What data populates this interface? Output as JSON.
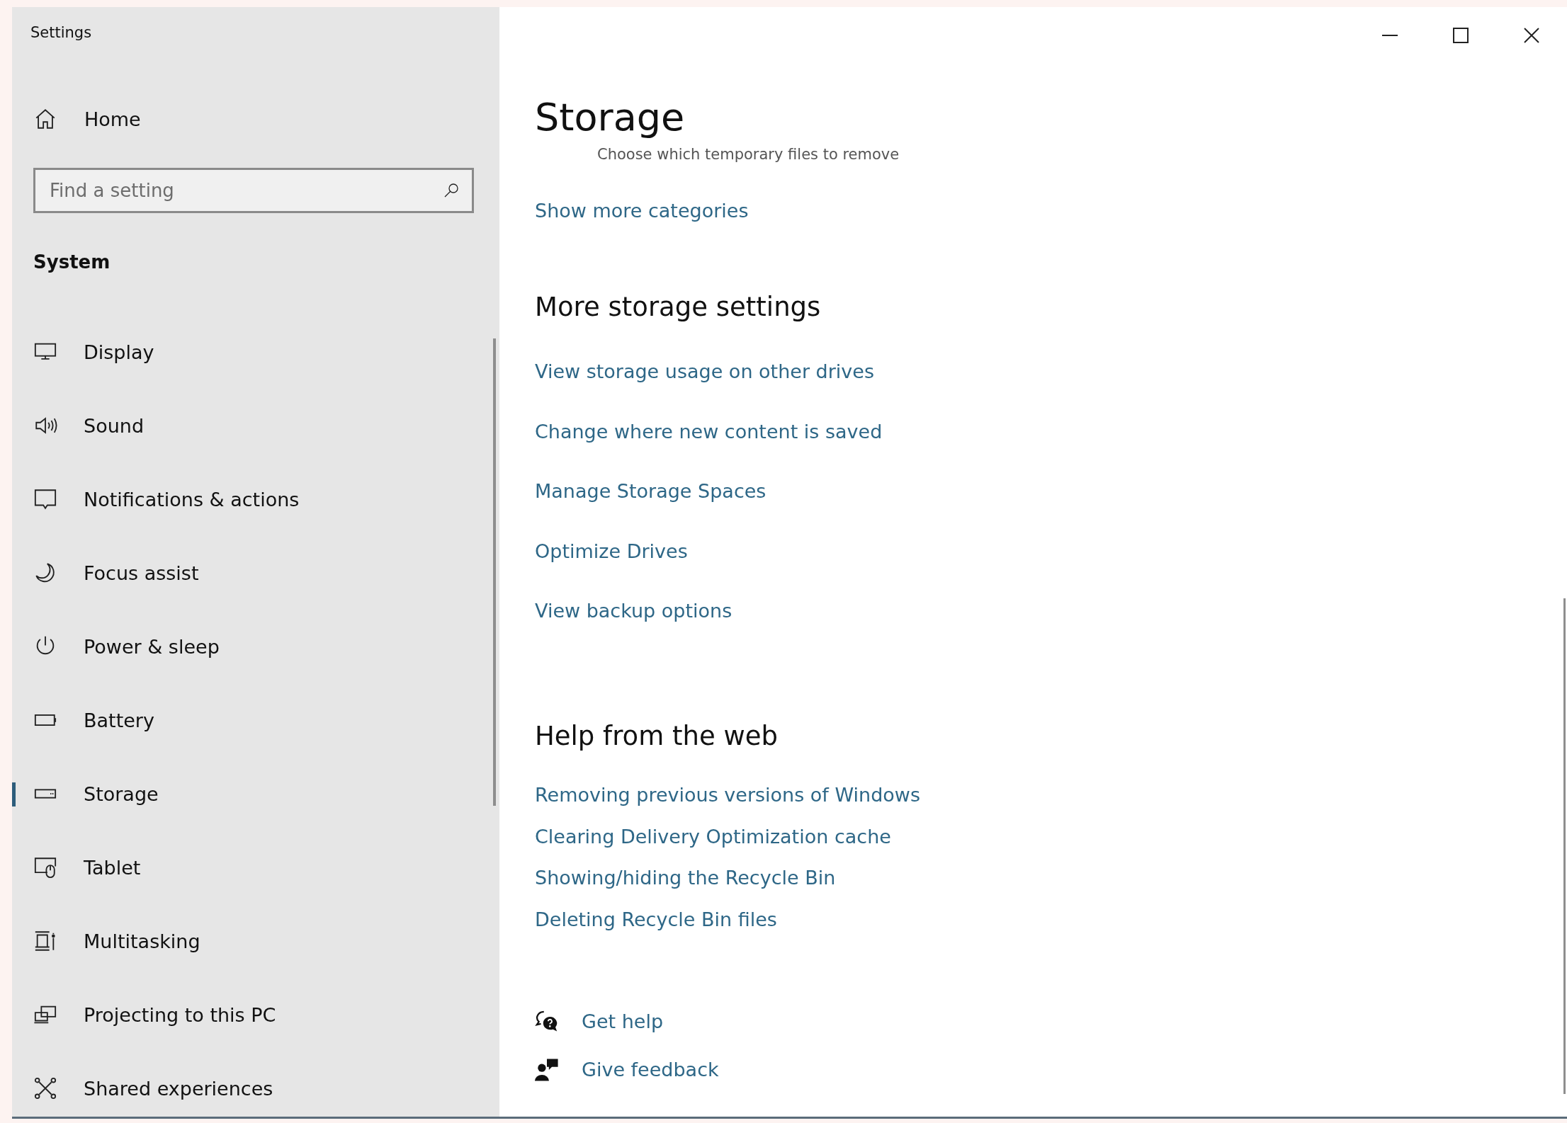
{
  "window": {
    "title": "Settings"
  },
  "sidebar": {
    "home": "Home",
    "search": {
      "placeholder": "Find a setting"
    },
    "section": "System",
    "items": [
      {
        "label": "Display",
        "selected": false
      },
      {
        "label": "Sound",
        "selected": false
      },
      {
        "label": "Notifications & actions",
        "selected": false
      },
      {
        "label": "Focus assist",
        "selected": false
      },
      {
        "label": "Power & sleep",
        "selected": false
      },
      {
        "label": "Battery",
        "selected": false
      },
      {
        "label": "Storage",
        "selected": true
      },
      {
        "label": "Tablet",
        "selected": false
      },
      {
        "label": "Multitasking",
        "selected": false
      },
      {
        "label": "Projecting to this PC",
        "selected": false
      },
      {
        "label": "Shared experiences",
        "selected": false
      }
    ]
  },
  "page": {
    "title": "Storage",
    "partial_text": "Choose which temporary files to remove",
    "show_more": "Show more categories",
    "sections": [
      {
        "heading": "More storage settings",
        "links": [
          "View storage usage on other drives",
          "Change where new content is saved",
          "Manage Storage Spaces",
          "Optimize Drives",
          "View backup options"
        ]
      },
      {
        "heading": "Help from the web",
        "links": [
          "Removing previous versions of Windows",
          "Clearing Delivery Optimization cache",
          "Showing/hiding the Recycle Bin",
          "Deleting Recycle Bin files"
        ]
      }
    ],
    "footer": [
      "Get help",
      "Give feedback"
    ]
  }
}
